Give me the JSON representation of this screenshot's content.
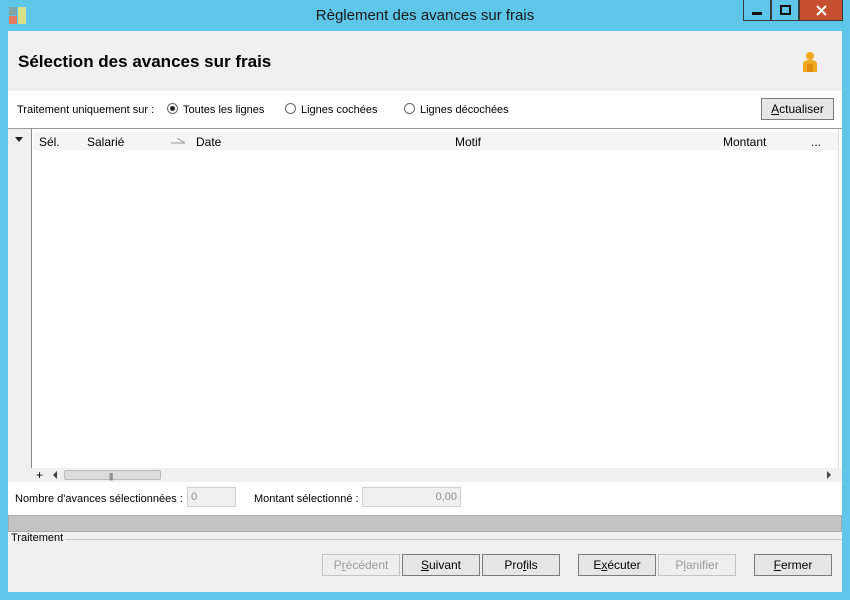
{
  "window": {
    "title": "Règlement des avances sur frais",
    "controls": {
      "minimize": "minimize-icon",
      "maximize": "maximize-icon",
      "close": "close-icon"
    }
  },
  "header": {
    "title": "Sélection des avances sur frais",
    "icon": "person-icon"
  },
  "filter": {
    "label": "Traitement uniquement sur :",
    "options": [
      {
        "label": "Toutes les lignes",
        "checked": true
      },
      {
        "label": "Lignes cochées",
        "checked": false
      },
      {
        "label": "Lignes décochées",
        "checked": false
      }
    ],
    "refresh_hotkey": "A",
    "refresh_rest": "ctualiser"
  },
  "grid": {
    "columns": [
      "Sél.",
      "Salarié",
      "Date",
      "Motif",
      "Montant",
      "..."
    ],
    "rows": [],
    "expand_glyph": "+"
  },
  "summary": {
    "count_label": "Nombre d'avances sélectionnées :",
    "count_value": "0",
    "amount_label": "Montant sélectionné :",
    "amount_value": "0,00"
  },
  "progress": {
    "value": 0
  },
  "footer": {
    "section_label": "Traitement",
    "buttons": [
      {
        "hotkey": "r",
        "pre": "P",
        "post": "écédent",
        "enabled": false
      },
      {
        "hotkey": "S",
        "pre": "",
        "post": "uivant",
        "enabled": true
      },
      {
        "hotkey": "f",
        "pre": "Pro",
        "post": "ils",
        "enabled": true
      },
      {
        "hotkey": "x",
        "pre": "E",
        "post": "écuter",
        "enabled": true
      },
      {
        "hotkey": "l",
        "pre": "P",
        "post": "anifier",
        "enabled": false
      },
      {
        "hotkey": "F",
        "pre": "",
        "post": "ermer",
        "enabled": true
      }
    ]
  },
  "colors": {
    "frame": "#5ec6e8",
    "close_button": "#c7502f",
    "panel": "#f0f0f0"
  }
}
